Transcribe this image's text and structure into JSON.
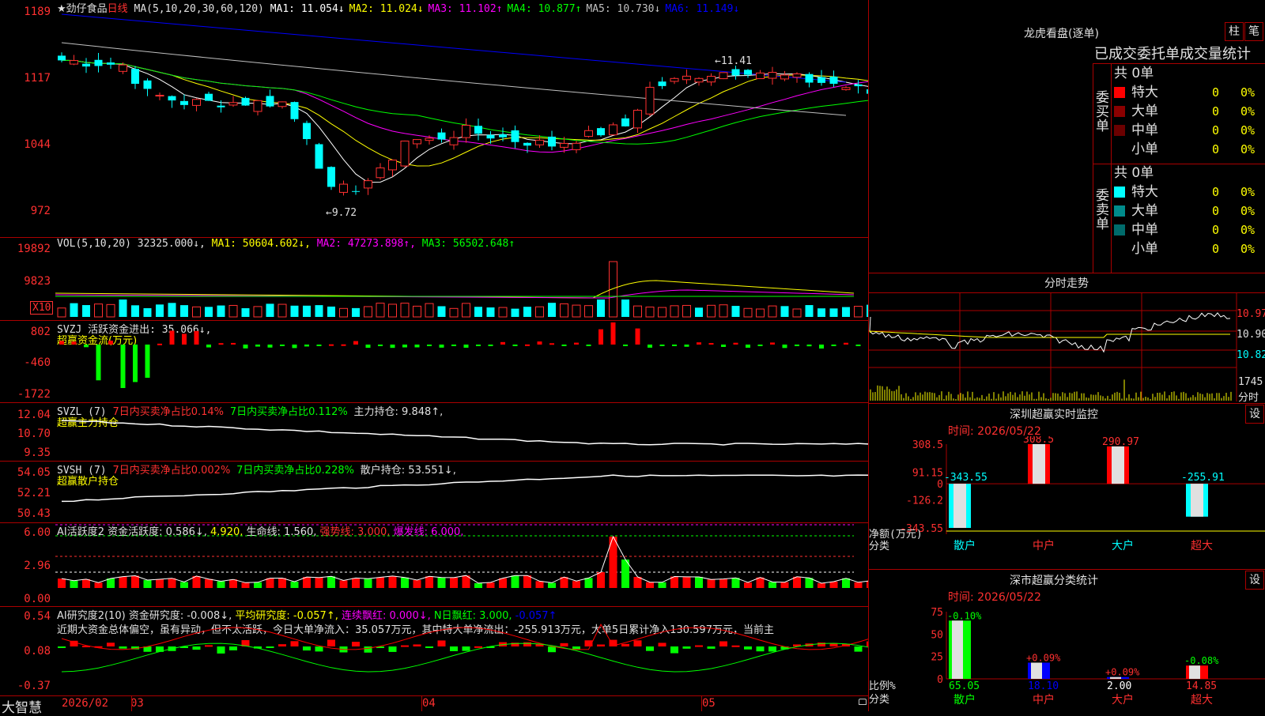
{
  "stock": {
    "name": "★劲仔食品",
    "period": "日线",
    "ma_prefix": "MA(5,10,20,30,60,120)",
    "ma": [
      {
        "label": "MA1:",
        "value": "11.054",
        "arrow": "↓",
        "color": "#ffffff"
      },
      {
        "label": "MA2:",
        "value": "11.024",
        "arrow": "↓",
        "color": "#ffff00"
      },
      {
        "label": "MA3:",
        "value": "11.102",
        "arrow": "↑",
        "color": "#ff00ff"
      },
      {
        "label": "MA4:",
        "value": "10.877",
        "arrow": "↑",
        "color": "#00ff00"
      },
      {
        "label": "MA5:",
        "value": "10.730",
        "arrow": "↓",
        "color": "#c0c0c0"
      },
      {
        "label": "MA6:",
        "value": "11.149",
        "arrow": "↓",
        "color": "#0000ff"
      }
    ],
    "y_ticks": [
      "1189",
      "1117",
      "1044",
      "972"
    ],
    "annotations": {
      "high": "11.41",
      "low": "9.72"
    }
  },
  "vol": {
    "header": "VOL(5,10,20)",
    "value": "32325.000↓,",
    "ma1": "MA1: 50604.602↓,",
    "ma2": "MA2: 47273.898↑,",
    "ma3": "MA3: 56502.648↑",
    "y_ticks": [
      "19892",
      "9823"
    ],
    "unit": "X10"
  },
  "svzj": {
    "header": "SVZJ  活跃资金进出: 35.066↓,",
    "subtitle": "超赢资金流(万元)",
    "y_ticks": [
      "802",
      "-460",
      "-1722"
    ]
  },
  "svzl": {
    "header_a": "SVZL (7)",
    "header_b": "7日内买卖净占比0.14%",
    "header_c": "7日内买卖净占比0.112%",
    "header_d": "主力持仓: 9.848↑,",
    "subtitle": "超赢主力持仓",
    "y_ticks": [
      "12.04",
      "10.70",
      "9.35"
    ]
  },
  "svsh": {
    "header_a": "SVSH (7)",
    "header_b": "7日内买卖净占比0.002%",
    "header_c": "7日内买卖净占比0.228%",
    "header_d": "散户持仓: 53.551↓,",
    "subtitle": "超赢散户持仓",
    "y_ticks": [
      "54.05",
      "52.21",
      "50.43"
    ]
  },
  "ai2": {
    "header_a": "AI活跃度2 资金活跃度: 0.586↓,",
    "header_b": "4.920,",
    "header_c": "生命线: 1.560,",
    "header_d": "强势线: 3.000,",
    "header_e": "爆发线: 6.000,",
    "y_ticks": [
      "6.00",
      "2.96",
      "0.00"
    ]
  },
  "ai_research": {
    "header_a": "AI研究度2(10) 资金研究度: -0.008↓,",
    "header_b": "平均研究度: -0.057↑,",
    "header_c": "连续飘红: 0.000↓,",
    "header_d": "N日飘红: 3.000,",
    "header_e": "-0.057↑",
    "comment": "近期大资金总体偏空，虽有异动，但不太活跃，今日大单净流入：35.057万元，其中特大单净流出：-255.913万元，大单5日累计净入130.597万元，当前主",
    "y_ticks": [
      "0.54",
      "0.08",
      "-0.37"
    ]
  },
  "x_axis": {
    "brand": "大智慧",
    "labels": [
      "2026/02",
      "03",
      "04",
      "05"
    ]
  },
  "right": {
    "dragon_title": "龙虎看盘(逐单)",
    "btn_zhu": "柱",
    "btn_bi": "笔",
    "tabs_line": "已成交委托单成交量统计",
    "buy": {
      "total": "共 0单",
      "side_label": "委买单",
      "rows": [
        {
          "label": "特大",
          "count": "0",
          "pct": "0%",
          "color": "#ff0000"
        },
        {
          "label": "大单",
          "count": "0",
          "pct": "0%",
          "color": "#8b0000"
        },
        {
          "label": "中单",
          "count": "0",
          "pct": "0%",
          "color": "#6b0000"
        },
        {
          "label": "小单",
          "count": "0",
          "pct": "0%",
          "color": "#000000"
        }
      ]
    },
    "sell": {
      "total": "共 0单",
      "side_label": "委卖单",
      "rows": [
        {
          "label": "特大",
          "count": "0",
          "pct": "0%",
          "color": "#00ffff"
        },
        {
          "label": "大单",
          "count": "0",
          "pct": "0%",
          "color": "#008b8b"
        },
        {
          "label": "中单",
          "count": "0",
          "pct": "0%",
          "color": "#006b6b"
        },
        {
          "label": "小单",
          "count": "0",
          "pct": "0%",
          "color": "#000000"
        }
      ]
    },
    "intraday": {
      "title": "分时走势",
      "price_ticks": [
        "10.97",
        "10.90",
        "10.82"
      ],
      "vol_tick": "1745",
      "vol_label": "分时"
    },
    "sz_monitor": {
      "title": "深圳超赢实时监控",
      "set": "设",
      "time": "时间: 2026/05/22",
      "y_ticks": [
        "308.5",
        "91.15",
        "0",
        "-126.2",
        "-343.55"
      ],
      "ylabel": "净额(万元)",
      "xlabel": "分类",
      "categories": [
        "散户",
        "中户",
        "大户",
        "超大"
      ],
      "values": [
        -343.55,
        308.5,
        290.97,
        -255.91
      ],
      "value_labels": [
        "-343.55",
        "308.5",
        "290.97",
        "-255.91"
      ]
    },
    "sz_class": {
      "title": "深市超赢分类统计",
      "set": "设",
      "time": "时间: 2026/05/22",
      "y_ticks": [
        "75",
        "50",
        "25",
        "0"
      ],
      "ylabel": "比例%",
      "xlabel": "分类",
      "categories": [
        "散户",
        "中户",
        "大户",
        "超大"
      ],
      "values": [
        65.05,
        18.1,
        2.0,
        14.85
      ],
      "value_labels": [
        "65.05",
        "18.10",
        "2.00",
        "14.85"
      ],
      "changes": [
        "-0.10%",
        "+0.09%",
        "+0.09%",
        "-0.08%"
      ]
    }
  },
  "chart_data": {
    "type": "bar",
    "title": "深圳超赢实时监控",
    "categories": [
      "散户",
      "中户",
      "大户",
      "超大"
    ],
    "values": [
      -343.55,
      308.5,
      290.97,
      -255.91
    ],
    "ylabel": "净额(万元)",
    "ylim": [
      -343.55,
      308.5
    ]
  }
}
